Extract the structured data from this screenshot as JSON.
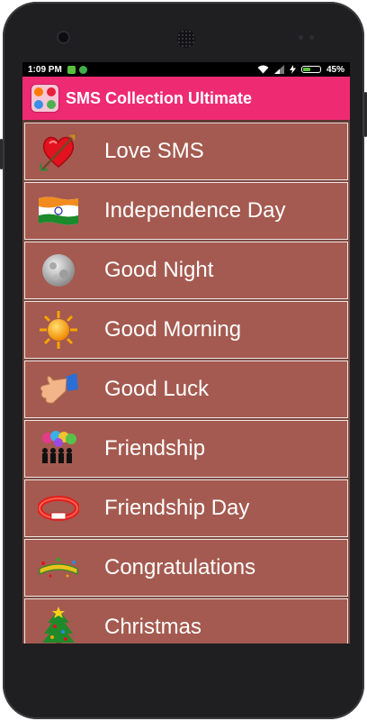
{
  "status_bar": {
    "time": "1:09 PM",
    "battery_text": "45%",
    "battery_level": 0.45
  },
  "app_bar": {
    "title": "SMS Collection Ultimate",
    "color": "#ee2a72",
    "logo_icon": "sms-collection-app-icon"
  },
  "menu": {
    "row_color": "#a45a50",
    "items": [
      {
        "label": "Love SMS",
        "icon": "heart-arrow-icon"
      },
      {
        "label": "Independence Day",
        "icon": "indian-flag-icon"
      },
      {
        "label": "Good Night",
        "icon": "moon-icon"
      },
      {
        "label": "Good Morning",
        "icon": "sun-icon"
      },
      {
        "label": "Good Luck",
        "icon": "thumbs-up-icon"
      },
      {
        "label": "Friendship",
        "icon": "friends-balloons-icon"
      },
      {
        "label": "Friendship Day",
        "icon": "friendship-band-icon"
      },
      {
        "label": "Congratulations",
        "icon": "congratulations-banner-icon"
      },
      {
        "label": "Christmas",
        "icon": "christmas-tree-icon"
      }
    ]
  }
}
